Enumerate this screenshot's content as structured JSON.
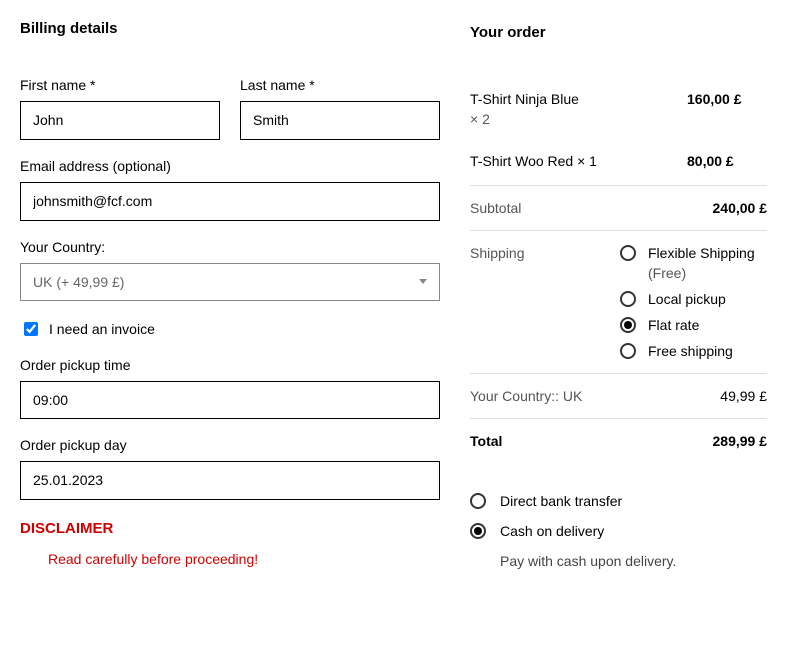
{
  "billing": {
    "heading": "Billing details",
    "first_name_label": "First name *",
    "first_name_value": "John",
    "last_name_label": "Last name *",
    "last_name_value": "Smith",
    "email_label": "Email address (optional)",
    "email_value": "johnsmith@fcf.com",
    "country_label": "Your Country:",
    "country_value": "UK (+ 49,99 £)",
    "invoice_label": "I need an invoice",
    "invoice_checked": true,
    "pickup_time_label": "Order pickup time",
    "pickup_time_value": "09:00",
    "pickup_day_label": "Order pickup day",
    "pickup_day_value": "25.01.2023",
    "disclaimer_head": "DISCLAIMER",
    "disclaimer_text": "Read carefully before proceeding!"
  },
  "order": {
    "heading": "Your order",
    "items": [
      {
        "name": "T-Shirt Ninja Blue",
        "qty": "× 2",
        "price": "160,00 £"
      },
      {
        "name": "T-Shirt Woo Red  × 1",
        "qty": "",
        "price": "80,00 £"
      }
    ],
    "subtotal_label": "Subtotal",
    "subtotal_value": "240,00 £",
    "shipping_label": "Shipping",
    "shipping_options": [
      {
        "label": "Flexible Shipping",
        "sublabel": "(Free)",
        "checked": false
      },
      {
        "label": "Local pickup",
        "checked": false
      },
      {
        "label": "Flat rate",
        "checked": true
      },
      {
        "label": "Free shipping",
        "checked": false
      }
    ],
    "country_row_label": "Your Country:: UK",
    "country_row_value": "49,99 £",
    "total_label": "Total",
    "total_value": "289,99 £",
    "payment_options": [
      {
        "label": "Direct bank transfer",
        "checked": false
      },
      {
        "label": "Cash on delivery",
        "checked": true,
        "desc": "Pay with cash upon delivery."
      }
    ]
  }
}
